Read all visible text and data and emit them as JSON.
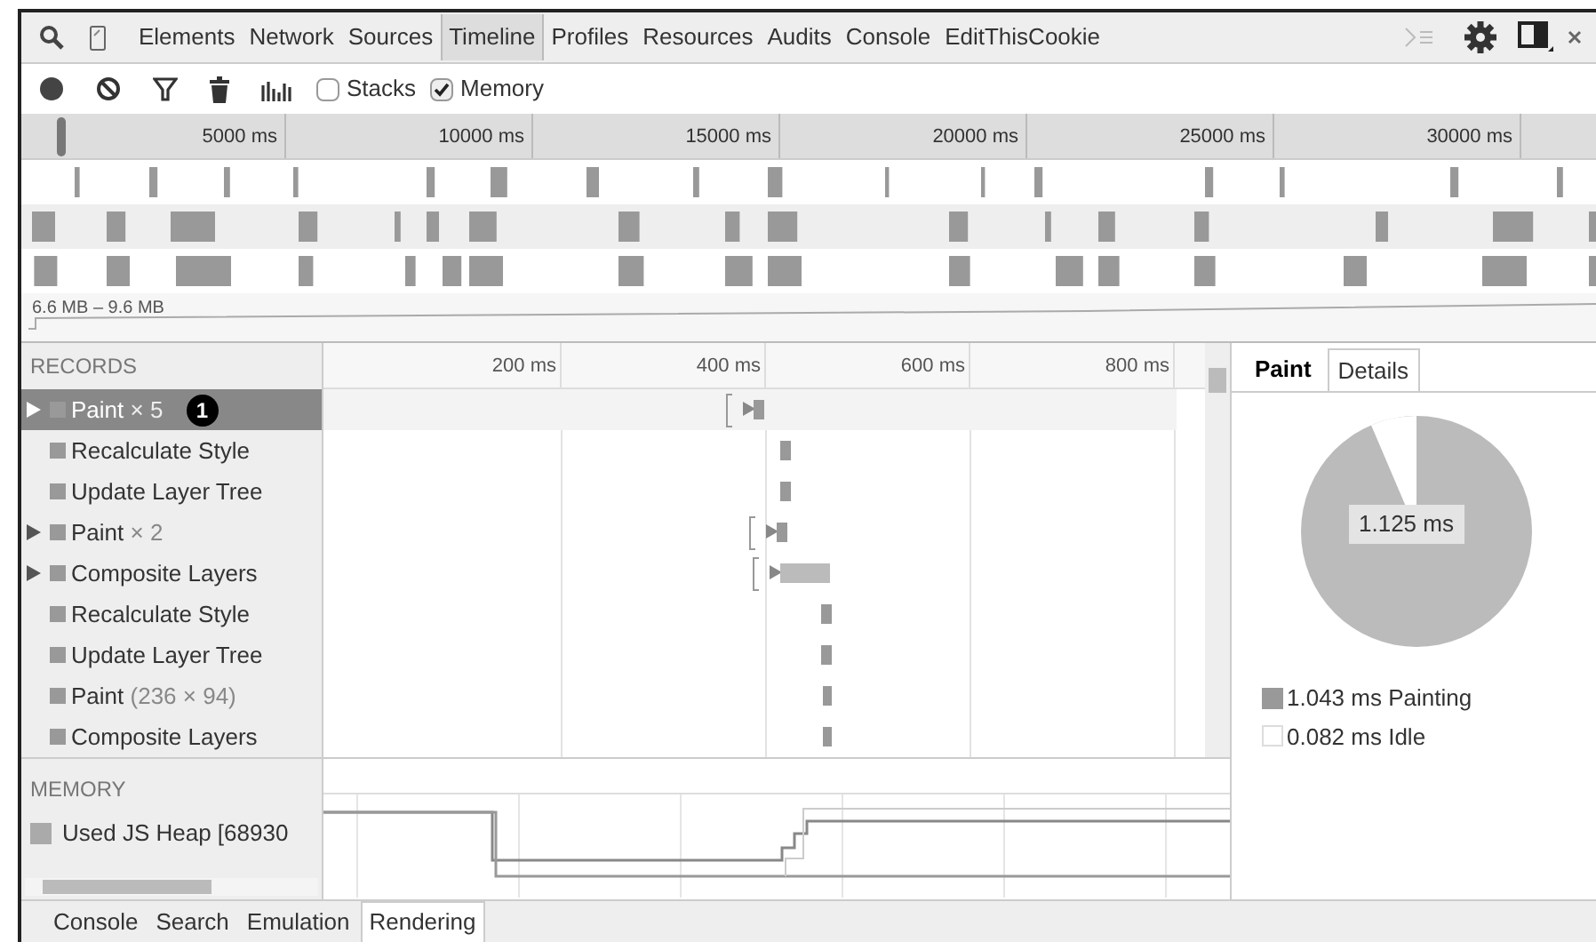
{
  "panel_tabs": [
    {
      "label": "Elements",
      "selected": false
    },
    {
      "label": "Network",
      "selected": false
    },
    {
      "label": "Sources",
      "selected": false
    },
    {
      "label": "Timeline",
      "selected": true
    },
    {
      "label": "Profiles",
      "selected": false
    },
    {
      "label": "Resources",
      "selected": false
    },
    {
      "label": "Audits",
      "selected": false
    },
    {
      "label": "Console",
      "selected": false
    },
    {
      "label": "EditThisCookie",
      "selected": false
    }
  ],
  "toolbar": {
    "checkboxes": [
      {
        "label": "Stacks",
        "checked": false
      },
      {
        "label": "Memory",
        "checked": true
      }
    ]
  },
  "overview": {
    "ticks": [
      "5000 ms",
      "10000 ms",
      "15000 ms",
      "20000 ms",
      "25000 ms",
      "30000 ms"
    ],
    "memory_range": "6.6 MB – 9.6 MB"
  },
  "records": {
    "header": "RECORDS",
    "ticks": [
      "200 ms",
      "400 ms",
      "600 ms",
      "800 ms"
    ],
    "items": [
      {
        "name": "Paint",
        "detail": "× 5",
        "expandable": true,
        "selected": true,
        "badge": "1"
      },
      {
        "name": "Recalculate Style",
        "expandable": false,
        "selected": false
      },
      {
        "name": "Update Layer Tree",
        "expandable": false,
        "selected": false
      },
      {
        "name": "Paint",
        "detail": "× 2",
        "expandable": true,
        "selected": false
      },
      {
        "name": "Composite Layers",
        "expandable": true,
        "selected": false
      },
      {
        "name": "Recalculate Style",
        "expandable": false,
        "selected": false
      },
      {
        "name": "Update Layer Tree",
        "expandable": false,
        "selected": false
      },
      {
        "name": "Paint",
        "detail": "(236 × 94)",
        "expandable": false,
        "selected": false
      },
      {
        "name": "Composite Layers",
        "expandable": false,
        "selected": false
      }
    ]
  },
  "memory": {
    "header": "MEMORY",
    "counters": [
      "Used JS Heap [68930"
    ]
  },
  "details": {
    "tabs": [
      {
        "label": "Paint",
        "selected": true
      },
      {
        "label": "Details",
        "selected": false
      }
    ],
    "total": "1.125 ms",
    "legend": [
      "1.043 ms Painting",
      "0.082 ms Idle"
    ]
  },
  "drawer_tabs": [
    {
      "label": "Console",
      "selected": false
    },
    {
      "label": "Search",
      "selected": false
    },
    {
      "label": "Emulation",
      "selected": false
    },
    {
      "label": "Rendering",
      "selected": true
    }
  ]
}
